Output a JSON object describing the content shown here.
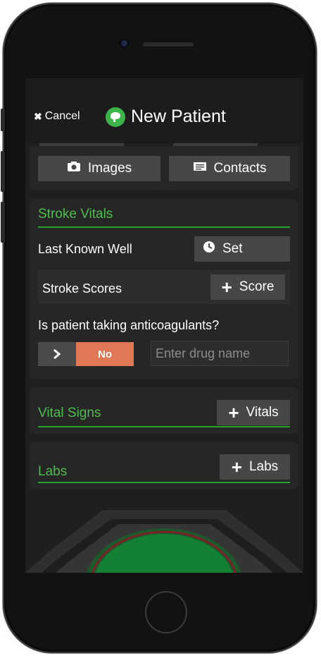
{
  "nav": {
    "cancel_label": "Cancel",
    "title": "New Patient"
  },
  "media": {
    "images_label": "Images",
    "contacts_label": "Contacts"
  },
  "stroke_vitals": {
    "title": "Stroke Vitals",
    "last_known_well_label": "Last Known Well",
    "set_label": "Set",
    "stroke_scores_label": "Stroke Scores",
    "score_label": "Score",
    "anticoagulant_question": "Is patient taking anticoagulants?",
    "toggle_value": "No",
    "drug_placeholder": "Enter drug name"
  },
  "vital_signs": {
    "title": "Vital Signs",
    "add_label": "Vitals"
  },
  "labs": {
    "title": "Labs",
    "add_label": "Labs"
  },
  "colors": {
    "accent_green": "#4fbd51",
    "toggle_no": "#e07755",
    "background": "#1f1f1f"
  }
}
